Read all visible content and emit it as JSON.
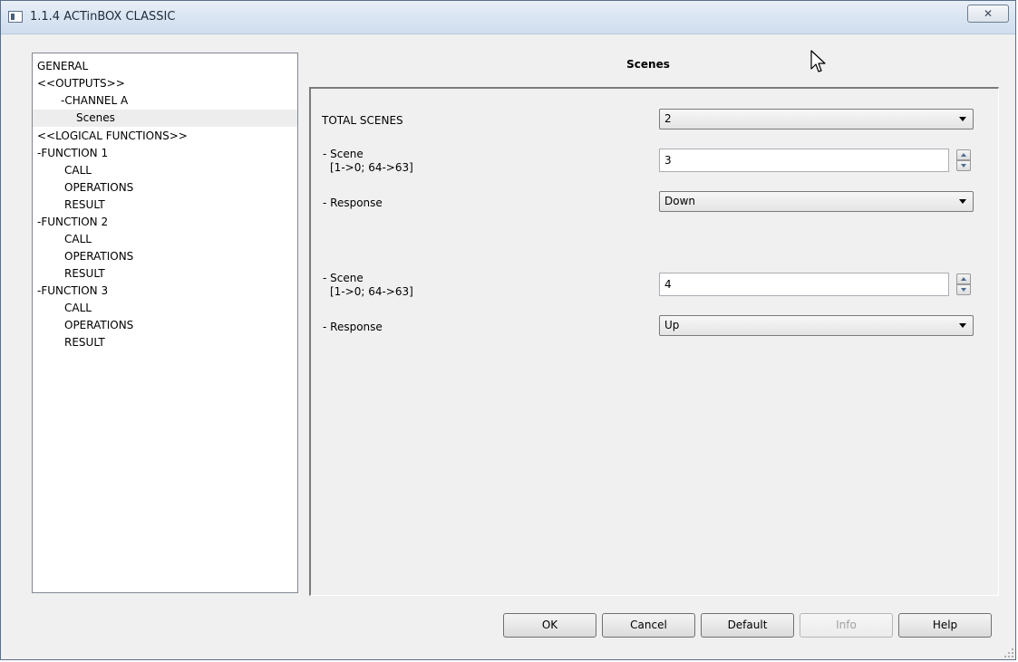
{
  "window": {
    "title": "1.1.4 ACTinBOX CLASSIC",
    "close_symbol": "✕"
  },
  "tree": {
    "items": [
      {
        "label": "GENERAL"
      },
      {
        "label": "<<OUTPUTS>>"
      },
      {
        "label": "-CHANNEL A"
      },
      {
        "label": "Scenes",
        "selected": true
      },
      {
        "label": "<<LOGICAL FUNCTIONS>>"
      },
      {
        "label": "-FUNCTION 1"
      },
      {
        "label": "CALL"
      },
      {
        "label": "OPERATIONS"
      },
      {
        "label": "RESULT"
      },
      {
        "label": "-FUNCTION 2"
      },
      {
        "label": "CALL"
      },
      {
        "label": "OPERATIONS"
      },
      {
        "label": "RESULT"
      },
      {
        "label": "-FUNCTION 3"
      },
      {
        "label": "CALL"
      },
      {
        "label": "OPERATIONS"
      },
      {
        "label": "RESULT"
      }
    ]
  },
  "panel": {
    "title": "Scenes",
    "total_scenes": {
      "label": "TOTAL SCENES",
      "value": "2"
    },
    "scene1": {
      "label": "- Scene",
      "sublabel": "[1->0; 64->63]",
      "value": "3",
      "response_label": "- Response",
      "response_value": "Down"
    },
    "scene2": {
      "label": "- Scene",
      "sublabel": "[1->0; 64->63]",
      "value": "4",
      "response_label": "- Response",
      "response_value": "Up"
    }
  },
  "buttons": {
    "ok": "OK",
    "cancel": "Cancel",
    "default": "Default",
    "info": "Info",
    "help": "Help"
  },
  "colors": {
    "window_bg": "#f0f0f0",
    "selection": "#ededed",
    "disabled_text": "#a0a0a0"
  }
}
